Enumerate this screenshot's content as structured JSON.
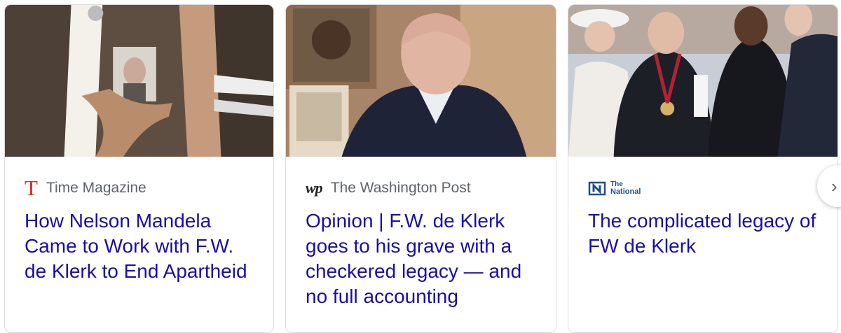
{
  "cards": [
    {
      "source": "Time Magazine",
      "logo": "T",
      "headline": "How Nelson Mandela Came to Work with F.W. de Klerk to End Apartheid"
    },
    {
      "source": "The Washington Post",
      "logo": "wp",
      "headline": "Opinion | F.W. de Klerk goes to his grave with a checkered legacy — and no full accounting"
    },
    {
      "source": "The National",
      "logo_line1": "The",
      "logo_line2": "National",
      "headline": "The complicated legacy of FW de Klerk"
    }
  ],
  "next_button": {
    "icon": "chevron-right-icon",
    "glyph": "›"
  },
  "colors": {
    "headline": "#1a0dab",
    "source": "#5f6368",
    "time_red": "#d93025",
    "border": "#dadce0"
  }
}
